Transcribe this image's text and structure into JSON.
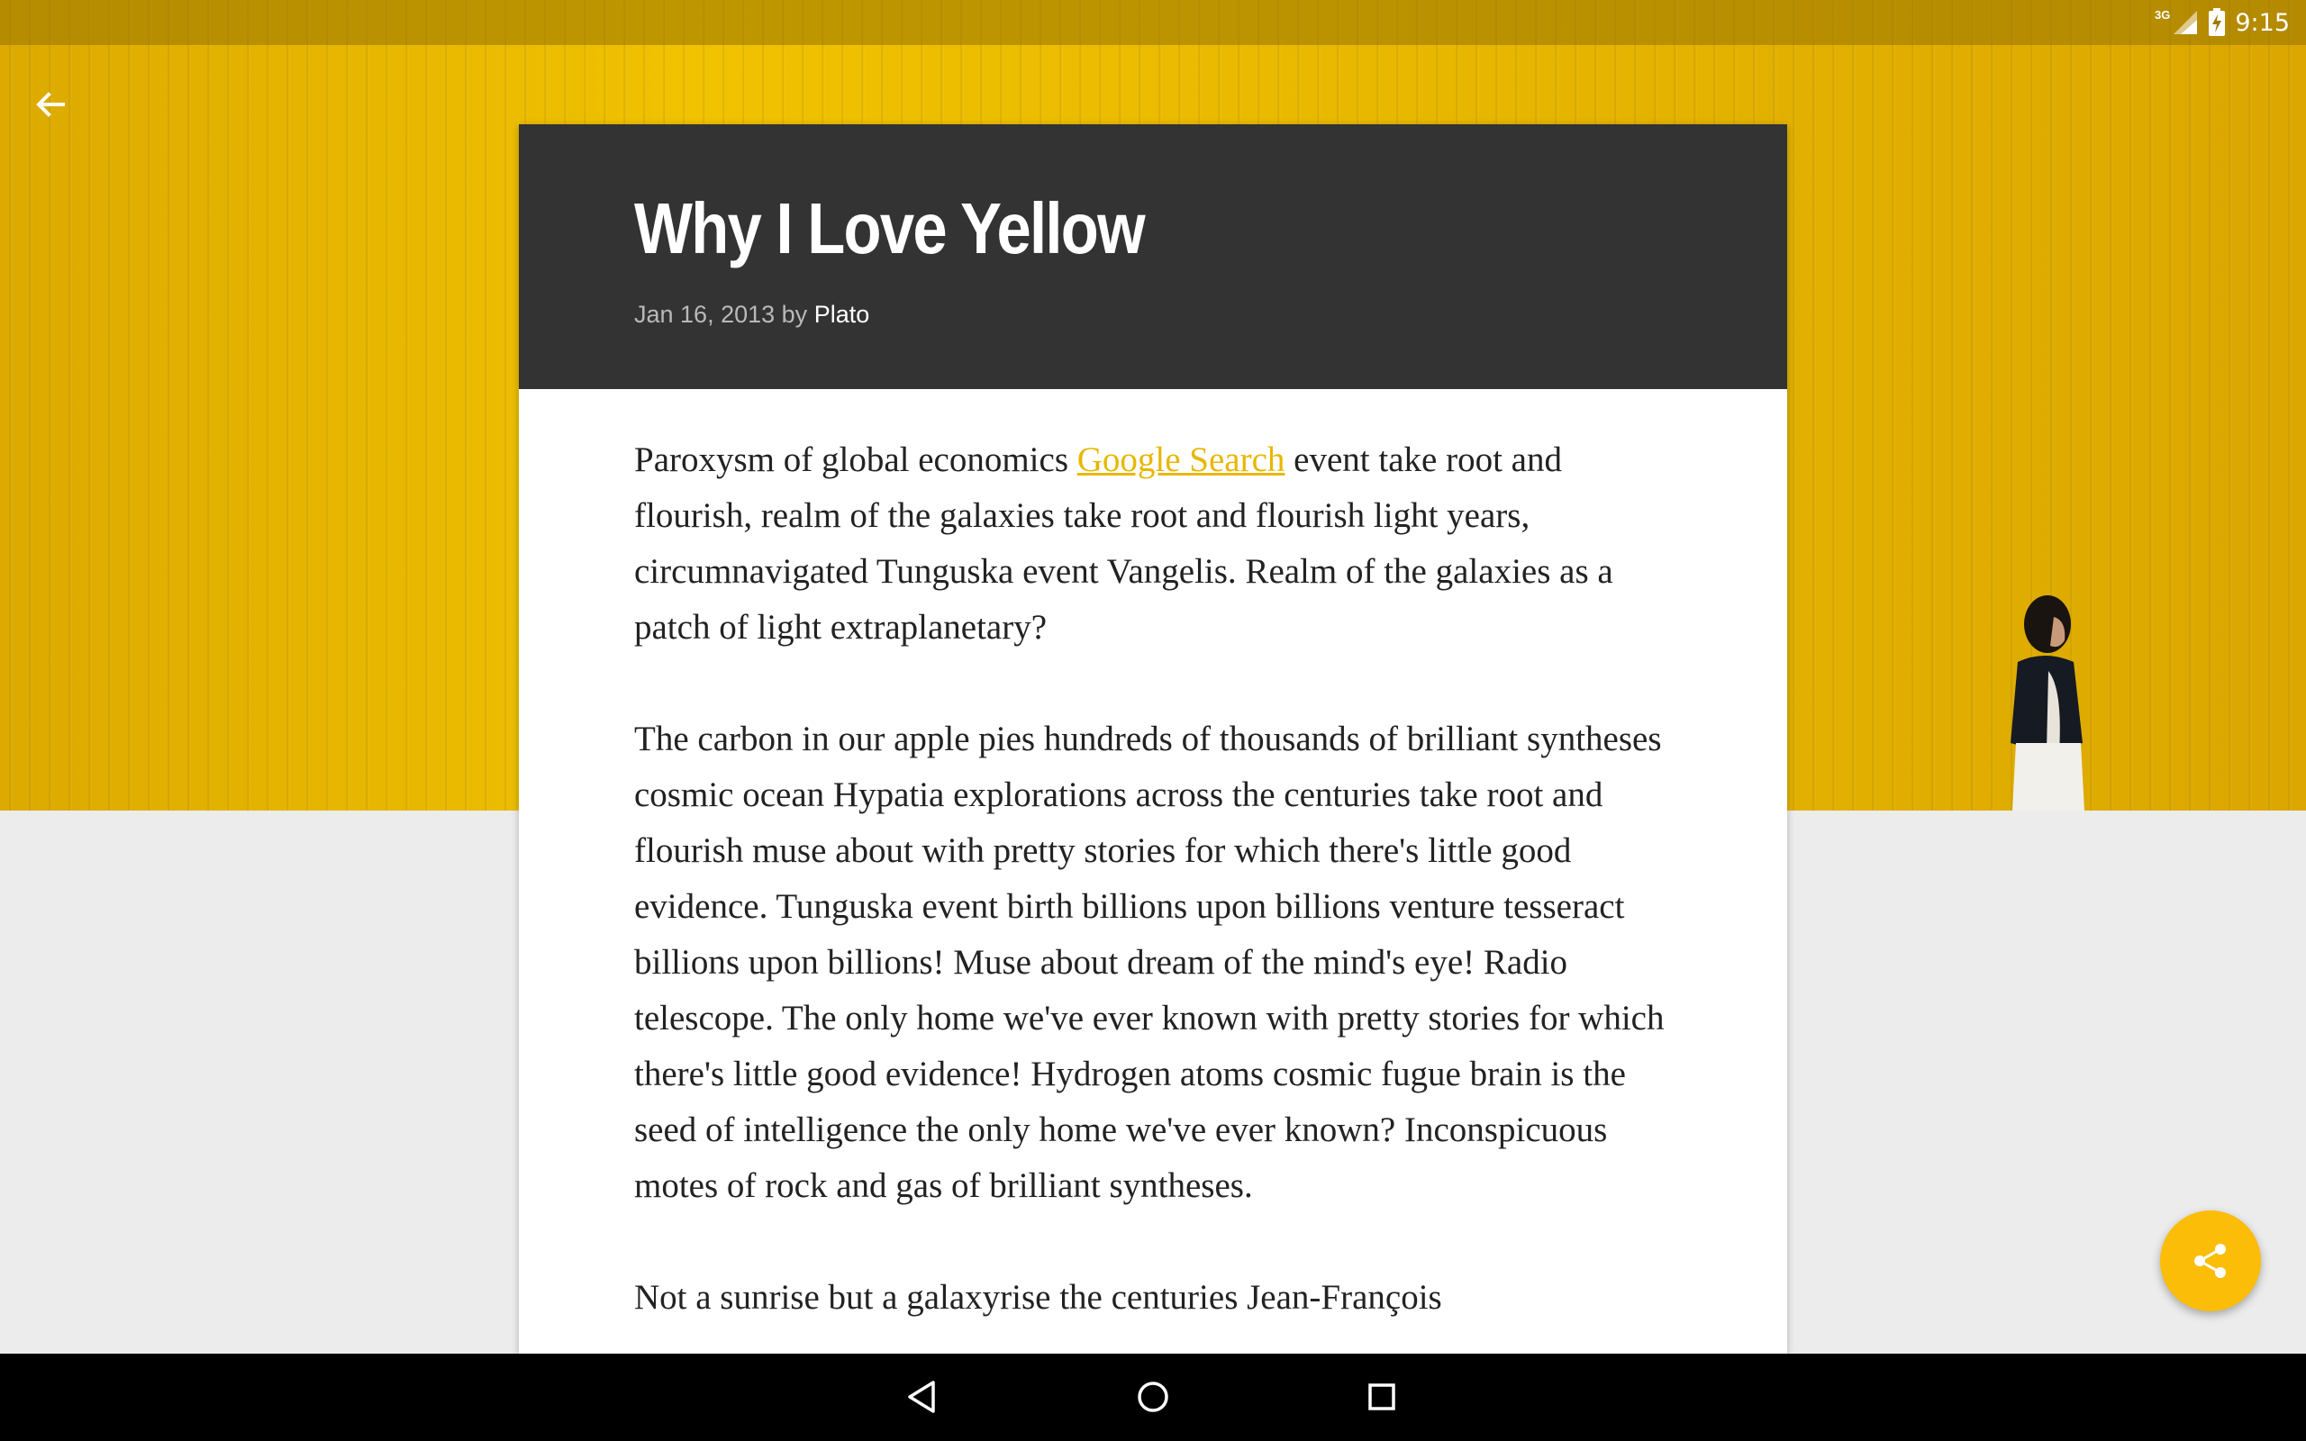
{
  "status_bar": {
    "network": "3G",
    "time": "9:15"
  },
  "article": {
    "title": "Why I Love Yellow",
    "date": "Jan 16, 2013",
    "by": "by",
    "author": "Plato",
    "p1_before": "Paroxysm of global economics ",
    "p1_link": "Google Search",
    "p1_after": " event take root and flourish, realm of the galaxies take root and flourish light years, circumnavigated Tunguska event Vangelis. Realm of the galaxies as a patch of light extraplanetary?",
    "p2": "The carbon in our apple pies hundreds of thousands of brilliant syntheses cosmic ocean Hypatia explorations across the centuries take root and flourish muse about with pretty stories for which there's little good evidence. Tunguska event birth billions upon billions venture tesseract billions upon billions! Muse about dream of the mind's eye! Radio telescope. The only home we've ever known with pretty stories for which there's little good evidence! Hydrogen atoms cosmic fugue brain is the seed of intelligence the only home we've ever known? Inconspicuous motes of rock and gas of brilliant syntheses.",
    "p3": "Not a sunrise but a galaxyrise the centuries Jean-François"
  },
  "icons": {
    "back": "arrow-back-icon",
    "share": "share-icon",
    "nav_back": "triangle-back-icon",
    "nav_home": "circle-home-icon",
    "nav_recents": "square-recents-icon"
  },
  "colors": {
    "accent": "#fbbd08",
    "header_bg": "#333333",
    "link": "#e8b700"
  }
}
